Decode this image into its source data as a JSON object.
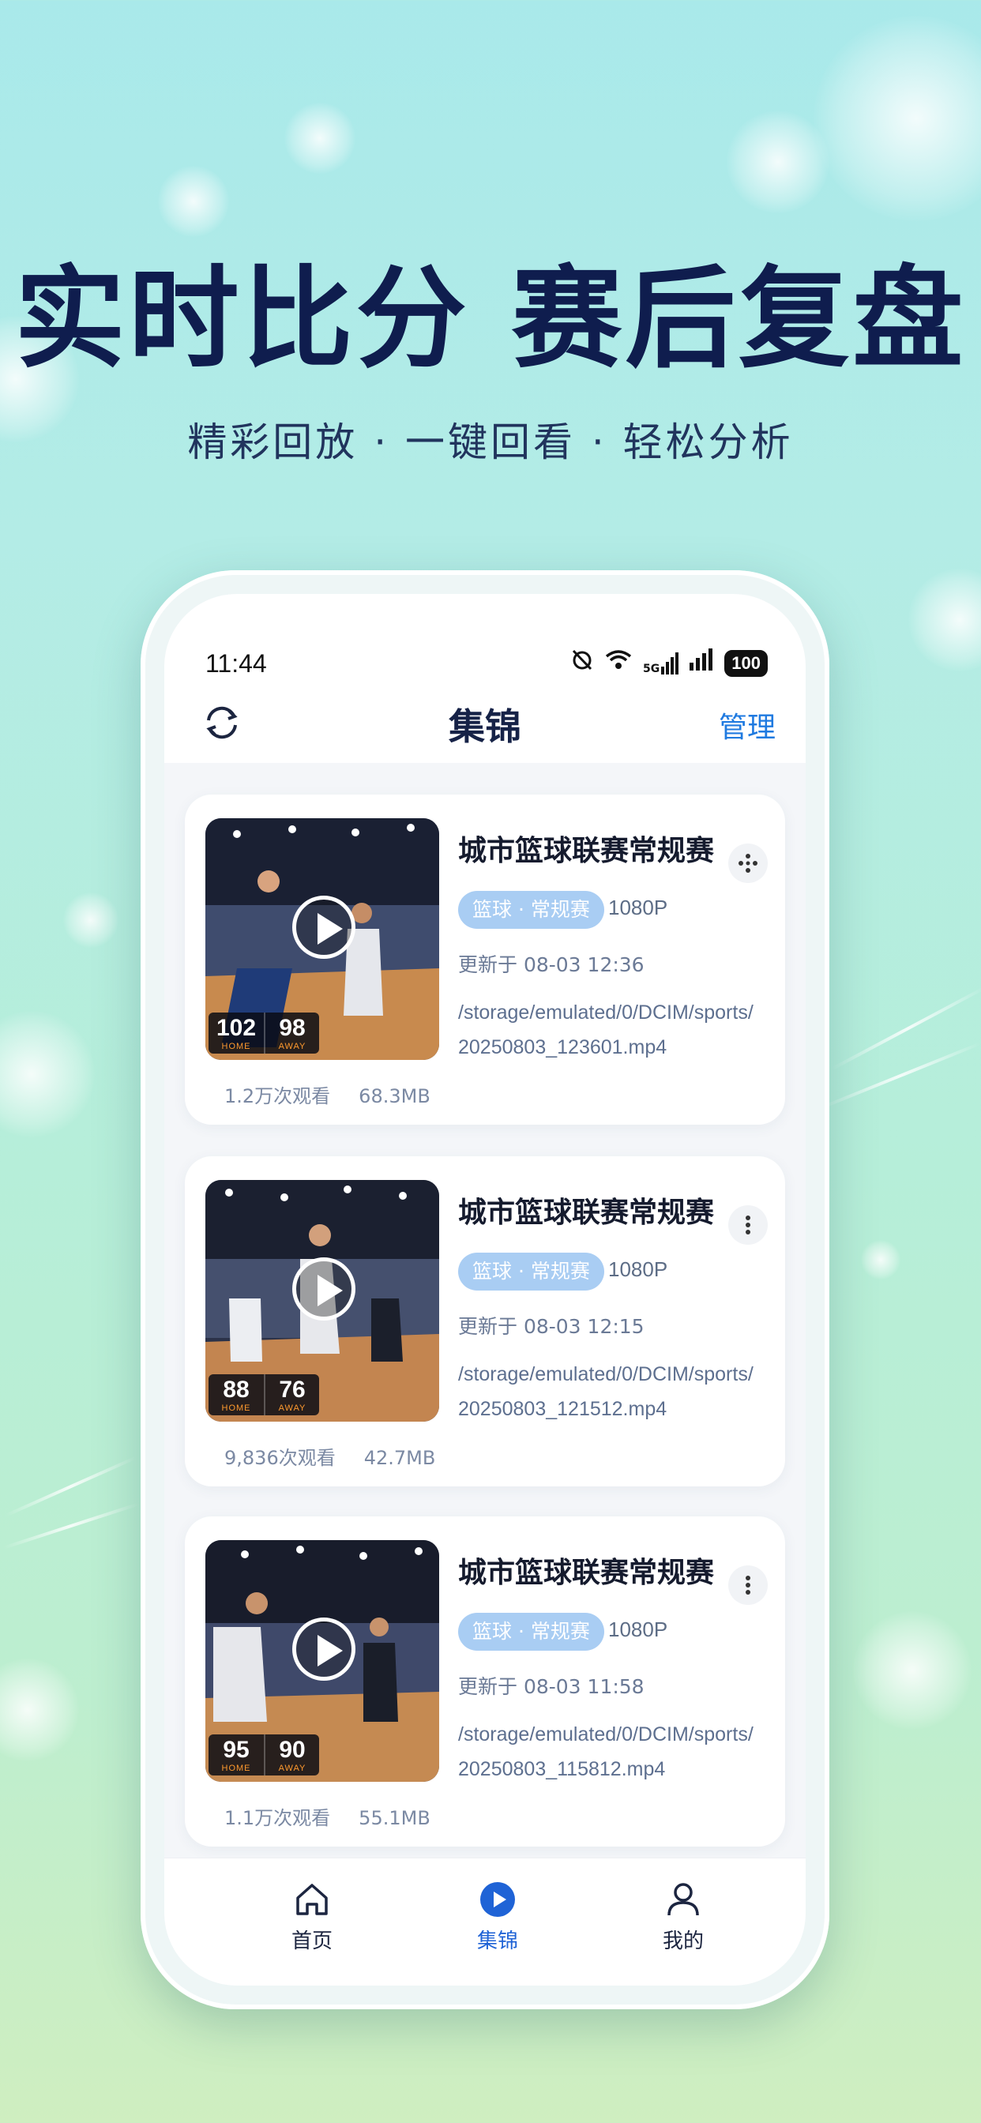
{
  "promo": {
    "headline": "实时比分 赛后复盘",
    "subline": "精彩回放 · 一键回看 · 轻松分析"
  },
  "status_bar": {
    "time": "11:44",
    "network": "5G",
    "battery": "100",
    "icons": [
      "alarm-off-icon",
      "wifi-icon",
      "cellular-5g-icon",
      "cellular-signal-icon",
      "battery-icon"
    ]
  },
  "app_bar": {
    "title": "集锦",
    "manage_label": "管理",
    "refresh_icon": "refresh-icon"
  },
  "highlights": [
    {
      "title": "城市篮球联赛常规赛",
      "tag": "篮球 · 常规赛",
      "resolution": "1080P",
      "updated": "更新于 08-03 12:36",
      "path": "/storage/emulated/0/DCIM/sports/20250803_123601.mp4",
      "home_score": "102",
      "away_score": "98",
      "home_label": "HOME",
      "away_label": "AWAY",
      "views": "1.2万次观看",
      "size": "68.3MB"
    },
    {
      "title": "城市篮球联赛常规赛",
      "tag": "篮球 · 常规赛",
      "resolution": "1080P",
      "updated": "更新于 08-03 12:15",
      "path": "/storage/emulated/0/DCIM/sports/20250803_121512.mp4",
      "home_score": "88",
      "away_score": "76",
      "home_label": "HOME",
      "away_label": "AWAY",
      "views": "9,836次观看",
      "size": "42.7MB"
    },
    {
      "title": "城市篮球联赛常规赛",
      "tag": "篮球 · 常规赛",
      "resolution": "1080P",
      "updated": "更新于 08-03 11:58",
      "path": "/storage/emulated/0/DCIM/sports/20250803_115812.mp4",
      "home_score": "95",
      "away_score": "90",
      "home_label": "HOME",
      "away_label": "AWAY",
      "views": "1.1万次观看",
      "size": "55.1MB"
    }
  ],
  "tab_bar": {
    "items": [
      {
        "label": "首页",
        "icon": "home-icon",
        "active": false
      },
      {
        "label": "集锦",
        "icon": "play-circle-icon",
        "active": true
      },
      {
        "label": "我的",
        "icon": "person-icon",
        "active": false
      }
    ]
  },
  "colors": {
    "accent": "#1f63d6",
    "manage_link": "#1f7ae0",
    "tag_bg": "#a9cdf3",
    "headline": "#0f1d4e"
  }
}
